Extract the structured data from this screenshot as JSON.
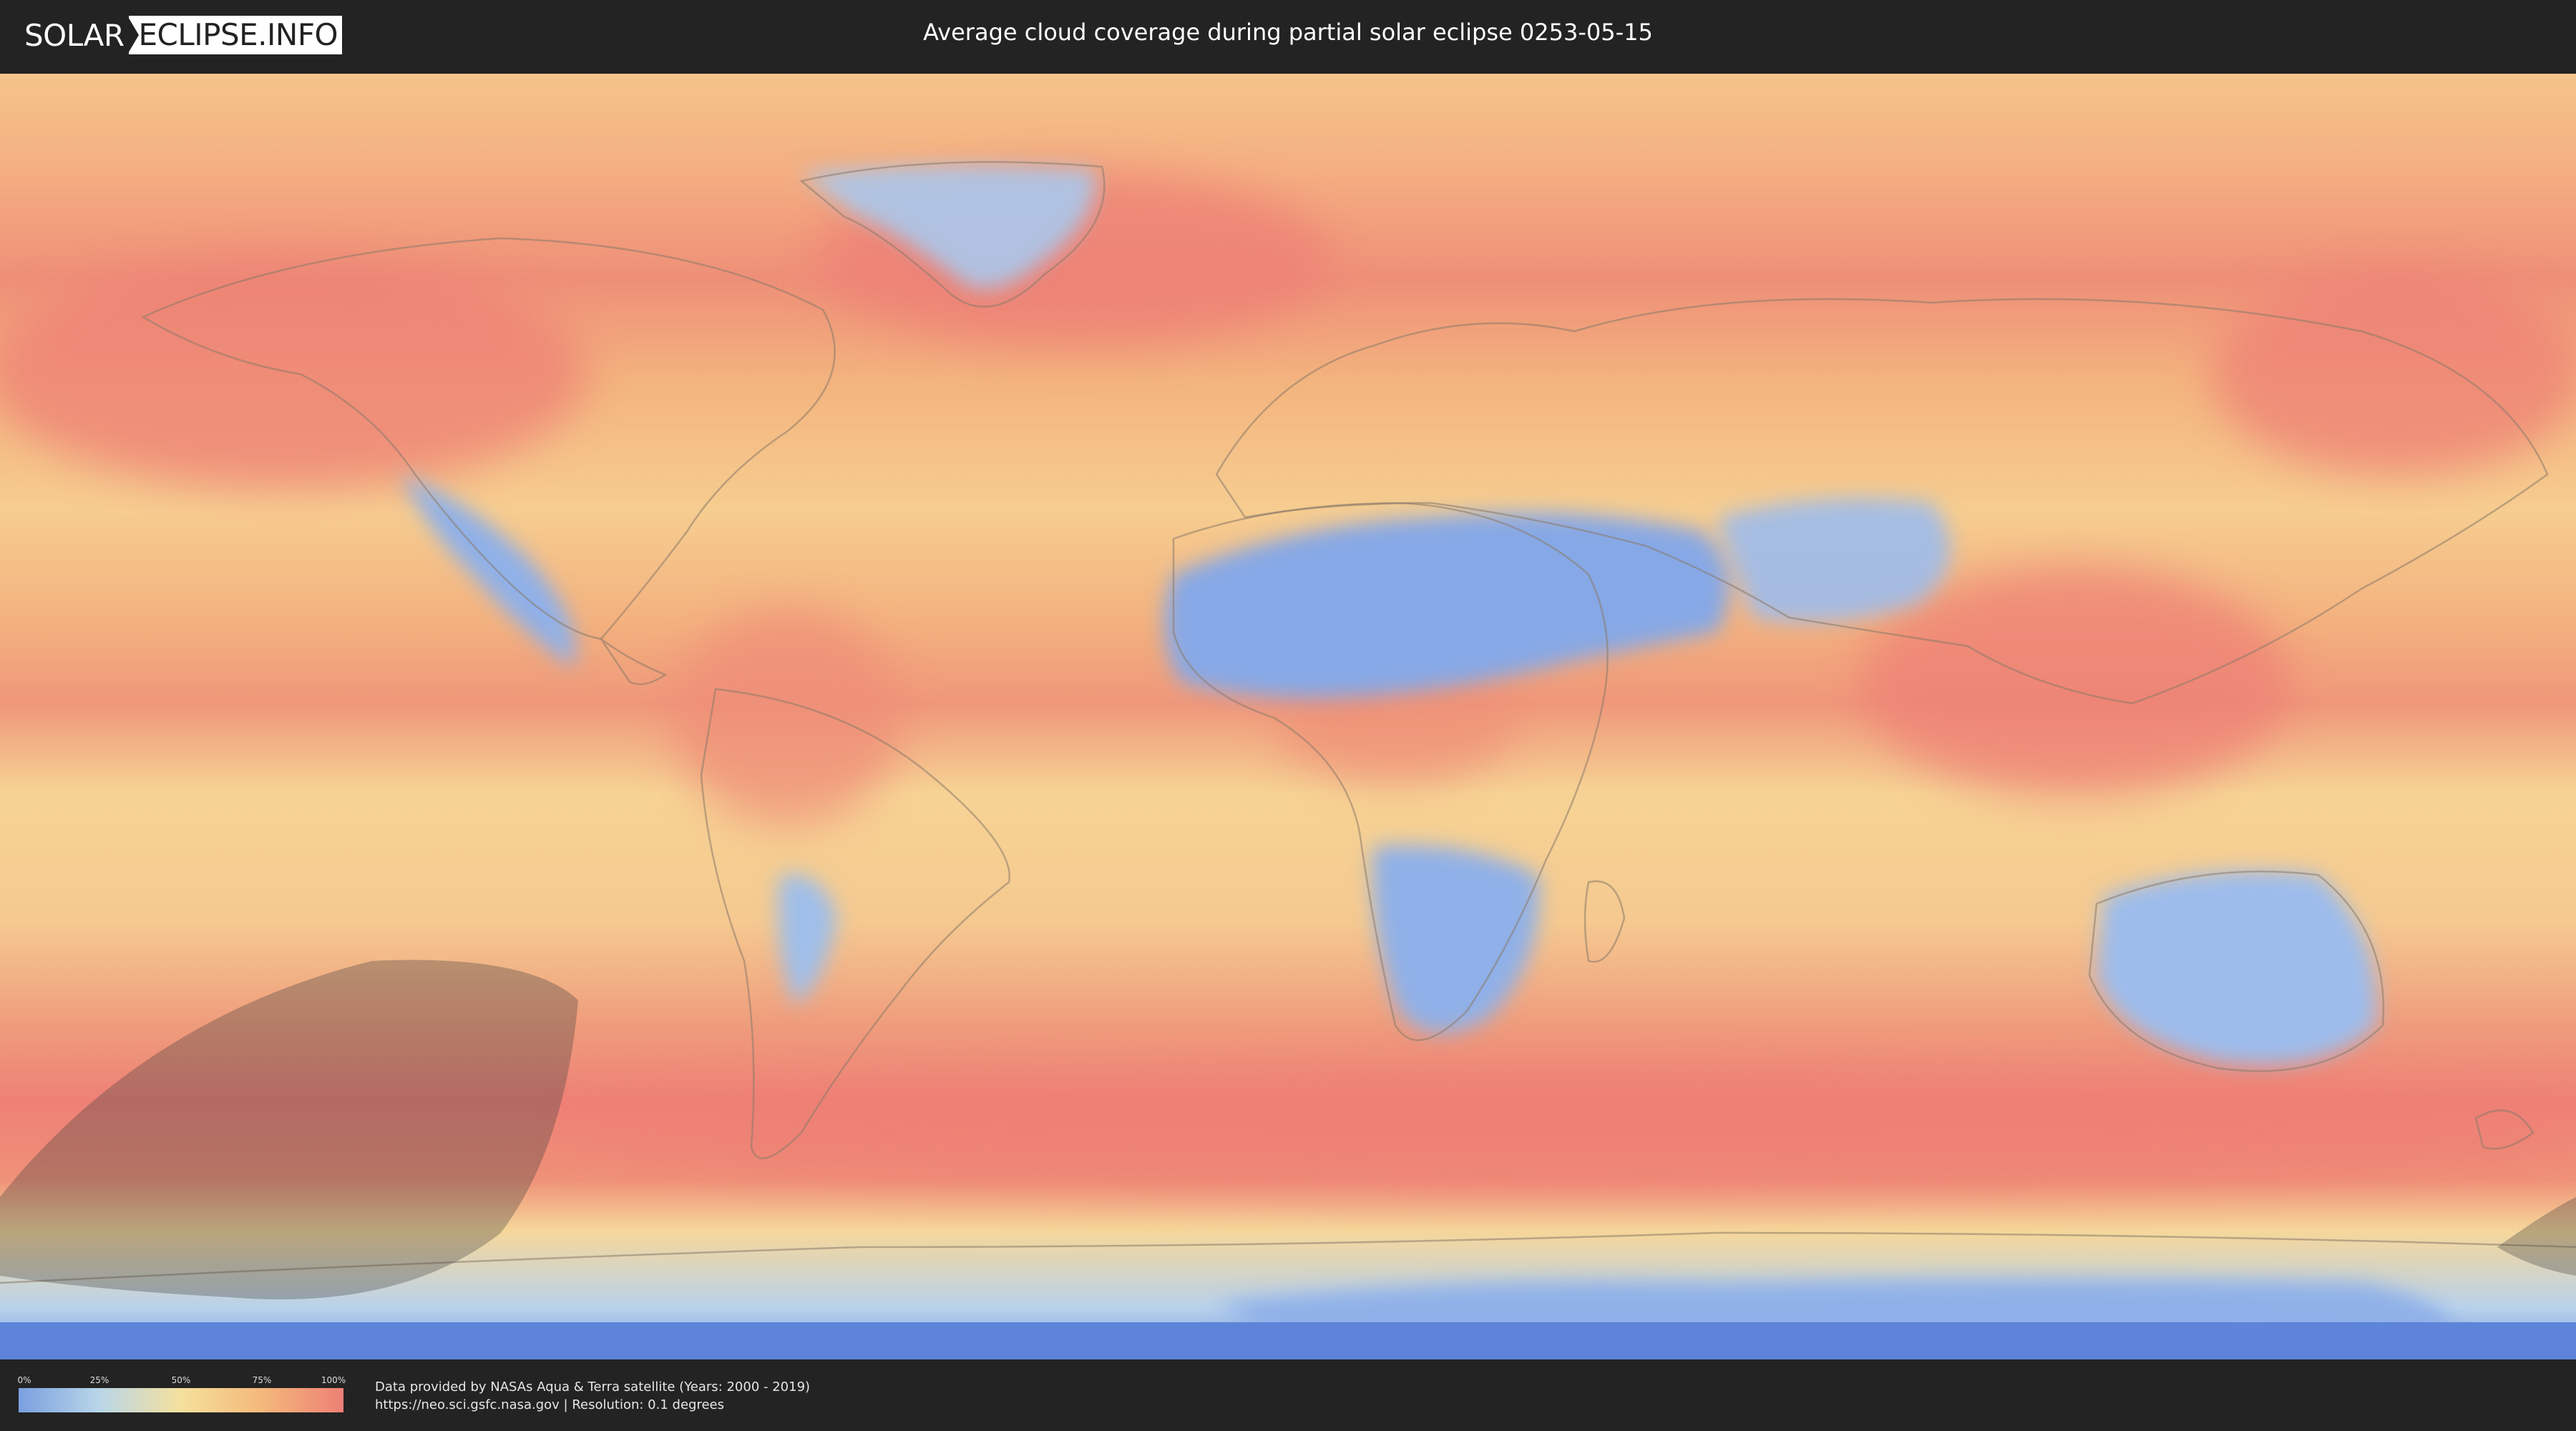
{
  "header": {
    "logo_solar": "SOLAR",
    "logo_eclipse": "ECLIPSE.INFO",
    "title": "Average cloud coverage during partial solar eclipse 0253-05-15"
  },
  "map": {
    "colors": {
      "clear": "#7aa0e0",
      "low": "#b9d6e8",
      "medium": "#f5e09c",
      "high": "#f4b87a",
      "overcast": "#ee8076",
      "eclipse_shadow": "#3a3a3a"
    }
  },
  "legend": {
    "ticks": [
      "0%",
      "25%",
      "50%",
      "75%",
      "100%"
    ]
  },
  "credits": {
    "line1": "Data provided by NASAs Aqua & Terra satellite (Years: 2000 - 2019)",
    "line2": "https://neo.sci.gsfc.nasa.gov | Resolution: 0.1 degrees"
  }
}
